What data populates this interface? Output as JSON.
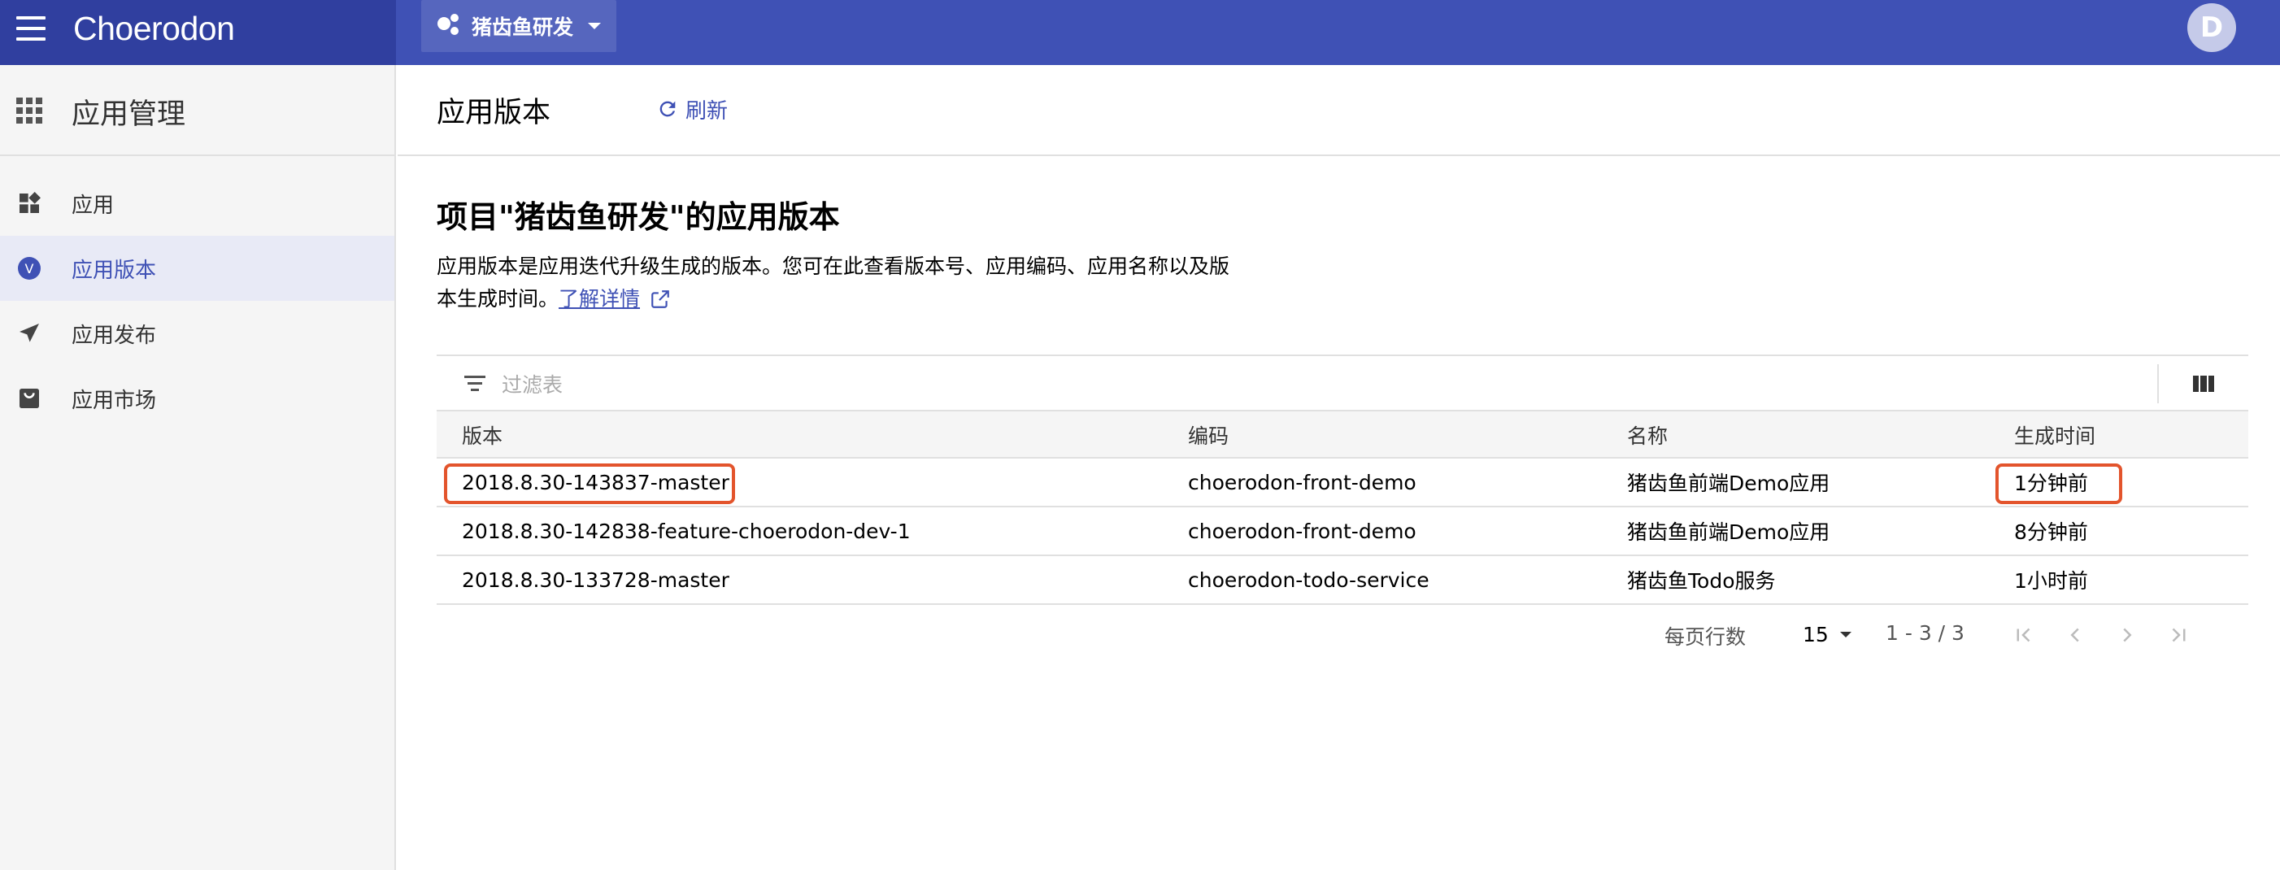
{
  "app": {
    "brand": "Choerodon",
    "avatar_initial": "D"
  },
  "header": {
    "project_name": "猪齿鱼研发"
  },
  "sidebar": {
    "title": "应用管理",
    "items": [
      {
        "label": "应用",
        "icon": "widgets-icon",
        "active": false
      },
      {
        "label": "应用版本",
        "icon": "version-badge-icon",
        "badge": "V",
        "active": true
      },
      {
        "label": "应用发布",
        "icon": "send-icon",
        "active": false
      },
      {
        "label": "应用市场",
        "icon": "store-icon",
        "active": false
      }
    ]
  },
  "main": {
    "page_title": "应用版本",
    "refresh_label": "刷新",
    "content_title": "项目\"猪齿鱼研发\"的应用版本",
    "description_line1": "应用版本是应用迭代升级生成的版本。您可在此查看版本号、应用编码、应用名称以及版",
    "description_line2": "本生成时间。",
    "learn_more": "了解详情"
  },
  "filter": {
    "placeholder": "过滤表"
  },
  "table": {
    "columns": [
      "版本",
      "编码",
      "名称",
      "生成时间"
    ],
    "rows": [
      {
        "version": "2018.8.30-143837-master",
        "code": "choerodon-front-demo",
        "name": "猪齿鱼前端Demo应用",
        "time": "1分钟前"
      },
      {
        "version": "2018.8.30-142838-feature-choerodon-dev-1",
        "code": "choerodon-front-demo",
        "name": "猪齿鱼前端Demo应用",
        "time": "8分钟前"
      },
      {
        "version": "2018.8.30-133728-master",
        "code": "choerodon-todo-service",
        "name": "猪齿鱼Todo服务",
        "time": "1小时前"
      }
    ]
  },
  "pagination": {
    "rows_per_page_label": "每页行数",
    "page_size": "15",
    "range": "1 - 3 / 3"
  },
  "colors": {
    "primary": "#3f51b5",
    "primary_dark": "#303f9f",
    "highlight": "#e3542c"
  }
}
